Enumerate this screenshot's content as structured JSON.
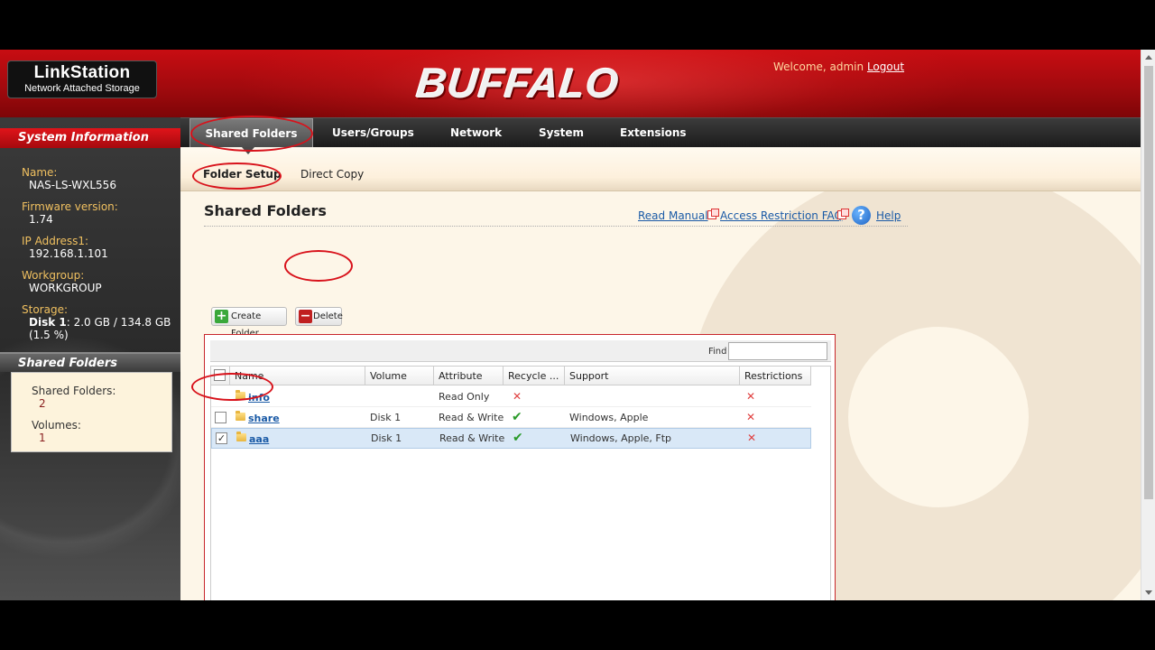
{
  "header": {
    "product_name": "LinkStation",
    "product_sub": "Network Attached Storage",
    "brand": "BUFFALO",
    "brand_tm": "™",
    "welcome": "Welcome, admin",
    "logout": "Logout"
  },
  "nav": {
    "tabs": [
      {
        "label": "Shared Folders",
        "active": true
      },
      {
        "label": "Users/Groups"
      },
      {
        "label": "Network"
      },
      {
        "label": "System"
      },
      {
        "label": "Extensions"
      }
    ]
  },
  "subnav": {
    "tabs": [
      {
        "label": "Folder Setup",
        "active": true
      },
      {
        "label": "Direct Copy"
      }
    ]
  },
  "sidebar": {
    "system_info_title": "System Information",
    "name_label": "Name:",
    "name_value": "NAS-LS-WXL556",
    "firmware_label": "Firmware version:",
    "firmware_value": "1.74",
    "ip_label": "IP Address1:",
    "ip_value": "192.168.1.101",
    "workgroup_label": "Workgroup:",
    "workgroup_value": "WORKGROUP",
    "storage_label": "Storage:",
    "storage_disk": "Disk 1",
    "storage_value": ": 2.0 GB / 134.8 GB",
    "storage_pct": "(1.5 %)",
    "shared_title": "Shared Folders",
    "shared_folders_label": "Shared Folders:",
    "shared_folders_value": "2",
    "volumes_label": "Volumes:",
    "volumes_value": "1"
  },
  "main": {
    "title": "Shared Folders",
    "read_manual": "Read Manual",
    "access_faq": "Access Restriction FAQ",
    "help": "Help",
    "create_folder": "Create Folder",
    "delete": "Delete",
    "find_label": "Find",
    "find_value": "",
    "columns": [
      "Name",
      "Volume",
      "Attribute",
      "Recycle ...",
      "Support",
      "Restrictions"
    ],
    "rows": [
      {
        "name": "info",
        "volume": "",
        "attribute": "Read Only",
        "recycle": "✕",
        "support": "",
        "restrictions": "✕",
        "checked": false,
        "checkbox_visible": false
      },
      {
        "name": "share",
        "volume": "Disk 1",
        "attribute": "Read & Write",
        "recycle": "✔",
        "support": "Windows, Apple",
        "restrictions": "✕",
        "checked": false,
        "checkbox_visible": true
      },
      {
        "name": "aaa",
        "volume": "Disk 1",
        "attribute": "Read & Write",
        "recycle": "✔",
        "support": "Windows, Apple, Ftp",
        "restrictions": "✕",
        "checked": true,
        "checkbox_visible": true,
        "selected": true
      }
    ]
  },
  "colors": {
    "accent_red": "#c80d12",
    "link_blue": "#1a5aa6",
    "selected_row": "#d9e8f7",
    "annotation_red": "#d8121b"
  },
  "icons": [
    "external-link-icon",
    "help-icon",
    "plus-icon",
    "minus-icon",
    "folder-icon",
    "check-icon",
    "cross-icon"
  ]
}
